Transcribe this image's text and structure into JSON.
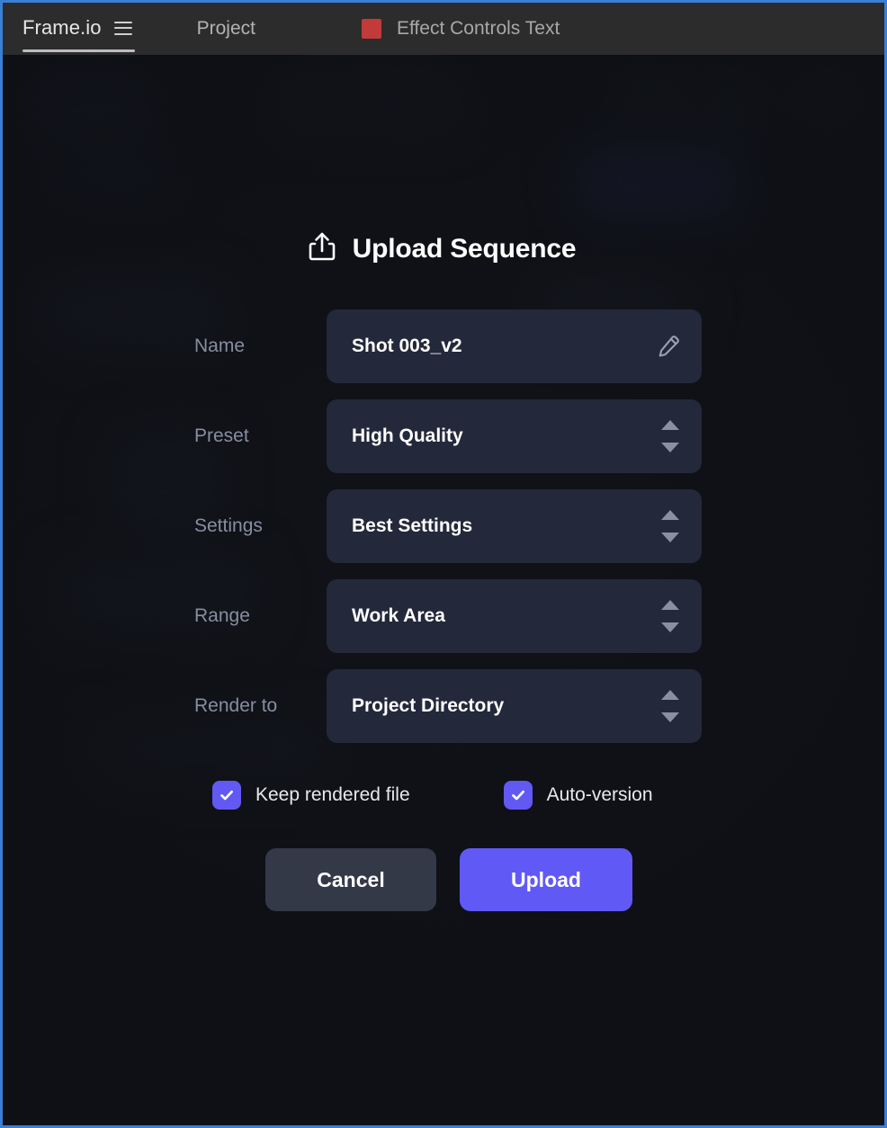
{
  "topbar": {
    "brand": "Frame.io",
    "menu_icon": "hamburger-icon",
    "project_label": "Project",
    "effect_swatch_color": "#c33a3a",
    "effect_label": "Effect Controls Text"
  },
  "dialog": {
    "title": "Upload Sequence",
    "title_icon": "upload-icon",
    "fields": [
      {
        "label": "Name",
        "value": "Shot 003_v2",
        "control": "text",
        "icon": "pencil-icon"
      },
      {
        "label": "Preset",
        "value": "High Quality",
        "control": "stepper",
        "icon": "stepper-icon"
      },
      {
        "label": "Settings",
        "value": "Best Settings",
        "control": "stepper",
        "icon": "stepper-icon"
      },
      {
        "label": "Range",
        "value": "Work Area",
        "control": "stepper",
        "icon": "stepper-icon"
      },
      {
        "label": "Render to",
        "value": "Project Directory",
        "control": "stepper",
        "icon": "stepper-icon"
      }
    ],
    "checkboxes": [
      {
        "label": "Keep rendered file",
        "checked": true
      },
      {
        "label": "Auto-version",
        "checked": true
      }
    ],
    "buttons": {
      "cancel": "Cancel",
      "upload": "Upload"
    }
  },
  "colors": {
    "accent": "#6159f5",
    "checkbox": "#6159f2",
    "field_bg": "#23283a",
    "cancel_bg": "#343948",
    "label": "#878ea0",
    "window_border": "#3a7fd5",
    "topbar_bg": "#2c2c2c",
    "canvas_bg": "#14161c"
  }
}
